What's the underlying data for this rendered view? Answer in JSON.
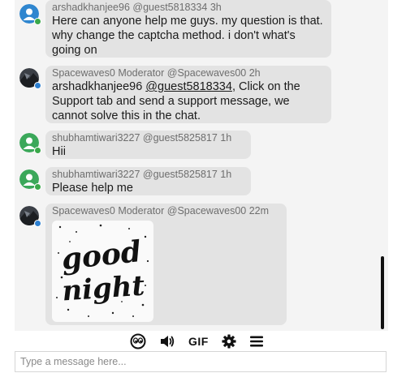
{
  "messages": [
    {
      "username": "arshadkhanjee96",
      "handle": "@guest5818334",
      "time": "3h",
      "text": "Here can anyone help me guys. my question is that. why change the captcha method. i don't what's going on"
    },
    {
      "username": "Spacewaves0",
      "role": "Moderator",
      "handle": "@Spacewaves00",
      "time": "2h",
      "text_prefix": "arshadkhanjee96 ",
      "mention": "@guest5818334",
      "text_suffix": ", Click on the Support tab and send a support message, we cannot solve this in the chat."
    },
    {
      "username": "shubhamtiwari3227",
      "handle": "@guest5825817",
      "time": "1h",
      "text": "Hii"
    },
    {
      "username": "shubhamtiwari3227",
      "handle": "@guest5825817",
      "time": "1h",
      "text": "Please help me"
    },
    {
      "username": "Spacewaves0",
      "role": "Moderator",
      "handle": "@Spacewaves00",
      "time": "22m",
      "image_text": [
        "good",
        "night"
      ]
    }
  ],
  "toolbar": {
    "gif_label": "GIF"
  },
  "input": {
    "placeholder": "Type a message here..."
  },
  "icons": [
    "user-avatar-icon",
    "moderator-avatar-icon",
    "emoji-icon",
    "speaker-icon",
    "settings-icon",
    "menu-icon"
  ],
  "colors": {
    "online_status": "#3aa84a",
    "moderator_status": "#2d7fd0",
    "bubble": "#e3e3e3"
  }
}
